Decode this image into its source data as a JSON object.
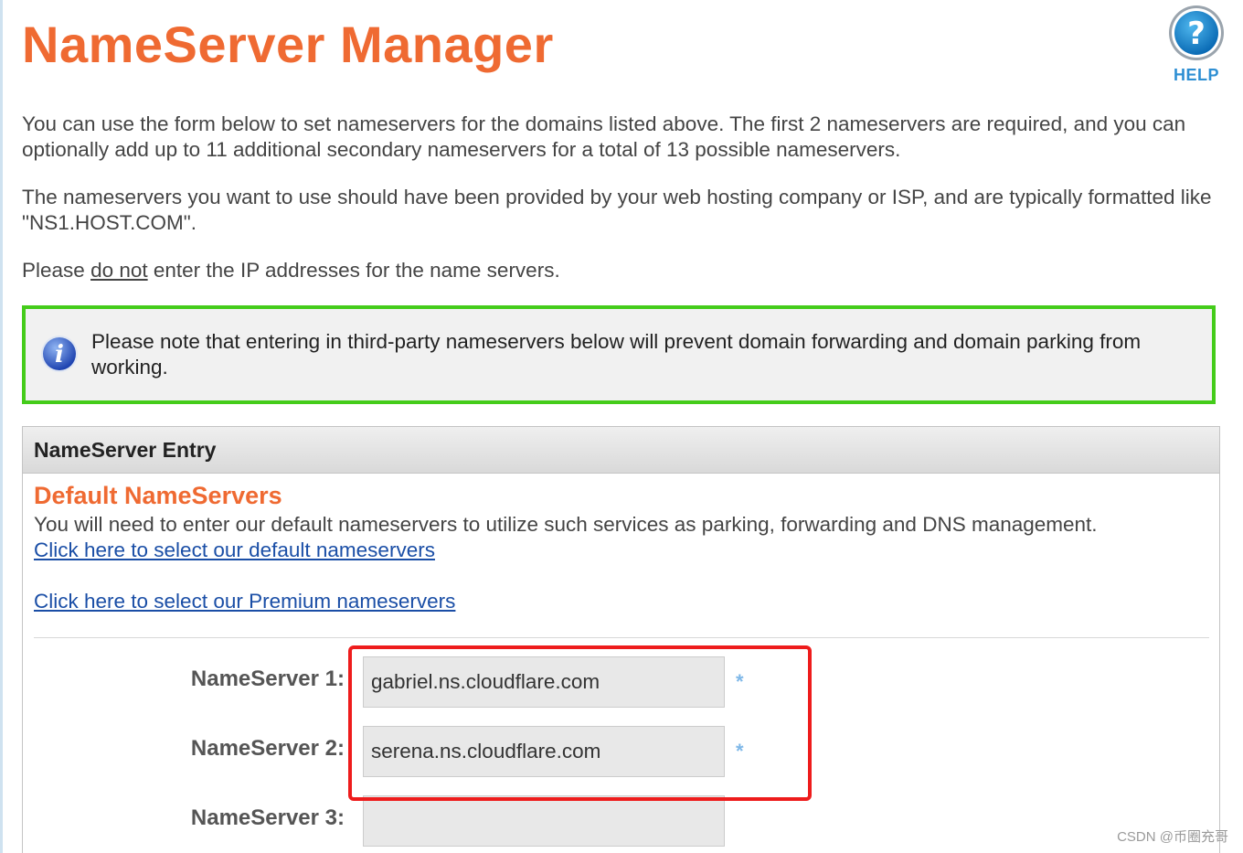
{
  "page": {
    "title": "NameServer Manager"
  },
  "help": {
    "label": "HELP",
    "icon": "question-mark-circle-icon"
  },
  "intro": {
    "paragraph1": "You can use the form below to set nameservers for the domains listed above. The first 2 nameservers are required, and you can optionally add up to 11 additional secondary nameservers for a total of 13 possible nameservers.",
    "paragraph2": "The nameservers you want to use should have been provided by your web hosting company or ISP, and are typically formatted like \"NS1.HOST.COM\".",
    "paragraph3_prefix": "Please ",
    "paragraph3_emphasis": "do not",
    "paragraph3_suffix": " enter the IP addresses for the name servers."
  },
  "notice": {
    "icon": "info-icon",
    "text": "Please note that entering in third-party nameservers below will prevent domain forwarding and domain parking from working.",
    "border_color": "#44cc1a"
  },
  "entry": {
    "header": "NameServer Entry",
    "section_title": "Default NameServers",
    "section_description": "You will need to enter our default nameservers to utilize such services as parking, forwarding and DNS management.",
    "link_default": "Click here to select our default nameservers",
    "link_premium": "Click here to select our Premium nameservers",
    "fields": [
      {
        "label": "NameServer 1:",
        "value": "gabriel.ns.cloudflare.com",
        "required_mark": "*"
      },
      {
        "label": "NameServer 2:",
        "value": "serena.ns.cloudflare.com",
        "required_mark": "*"
      },
      {
        "label": "NameServer 3:",
        "value": ""
      }
    ]
  },
  "annotation": {
    "highlight_color": "#ee1c1c"
  },
  "watermark": "CSDN @币圈充哥",
  "colors": {
    "title": "#ef6a32",
    "link": "#1a4ea6",
    "help": "#2e8fd3"
  }
}
